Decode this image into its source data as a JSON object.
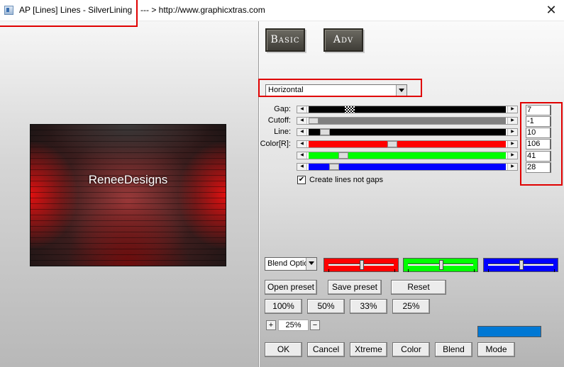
{
  "window": {
    "title": "AP [Lines]  Lines - SilverLining",
    "url_text": "--- > http://www.graphicxtras.com",
    "close_glyph": "✕"
  },
  "preview": {
    "watermark_text": "ReneeDesigns"
  },
  "tabs": [
    {
      "label": "Basic"
    },
    {
      "label": "Adv"
    }
  ],
  "mode_select": {
    "value": "Horizontal"
  },
  "sliders": [
    {
      "label": "Gap:",
      "value": "7",
      "level": 0.17,
      "fill": "#000000"
    },
    {
      "label": "Cutoff:",
      "value": "-1",
      "level": 0.0,
      "fill": "#808080"
    },
    {
      "label": "Line:",
      "value": "10",
      "level": 0.06,
      "fill": "#000000"
    },
    {
      "label": "Color[R]:",
      "value": "106",
      "level": 0.42,
      "fill": "#ff0000"
    },
    {
      "label": "",
      "value": "41",
      "level": 0.16,
      "fill": "#00ff00"
    },
    {
      "label": "",
      "value": "28",
      "level": 0.11,
      "fill": "#0000ff"
    }
  ],
  "checkbox": {
    "label": "Create lines not gaps",
    "checked": true,
    "glyph": "✔"
  },
  "blend": {
    "select_value": "Blend Optio",
    "color_sliders": [
      {
        "color": "#ff0000",
        "level": 0.5
      },
      {
        "color": "#00ff00",
        "level": 0.5
      },
      {
        "color": "#0000ff",
        "level": 0.5
      }
    ]
  },
  "preset_buttons": {
    "open": "Open preset",
    "save": "Save preset",
    "reset": "Reset"
  },
  "zoom_buttons": [
    "100%",
    "50%",
    "33%",
    "25%"
  ],
  "zoom": {
    "plus": "+",
    "value": "25%",
    "minus": "−"
  },
  "color_swatch": "#0078d4",
  "bottom_buttons": {
    "ok": "OK",
    "cancel": "Cancel",
    "xtreme": "Xtreme",
    "color": "Color",
    "blend": "Blend",
    "mode": "Mode"
  }
}
